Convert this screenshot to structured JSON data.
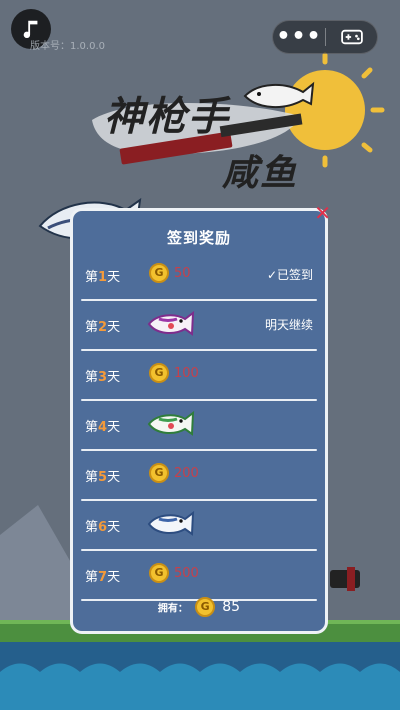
{
  "top": {
    "version": "版本号：1.0.0.0"
  },
  "logo": {
    "line1": "神枪手",
    "line2": "咸鱼"
  },
  "modal": {
    "title": "签到奖励",
    "close": "✕",
    "rows": [
      {
        "prefix": "第",
        "num": "1",
        "suffix": "天",
        "amount": "50",
        "status": "✓已签到"
      },
      {
        "prefix": "第",
        "num": "2",
        "suffix": "天",
        "amount": "",
        "status": "明天继续"
      },
      {
        "prefix": "第",
        "num": "3",
        "suffix": "天",
        "amount": "100",
        "status": ""
      },
      {
        "prefix": "第",
        "num": "4",
        "suffix": "天",
        "amount": "",
        "status": ""
      },
      {
        "prefix": "第",
        "num": "5",
        "suffix": "天",
        "amount": "200",
        "status": ""
      },
      {
        "prefix": "第",
        "num": "6",
        "suffix": "天",
        "amount": "",
        "status": ""
      },
      {
        "prefix": "第",
        "num": "7",
        "suffix": "天",
        "amount": "500",
        "status": ""
      }
    ],
    "footer_label": "拥有：",
    "coin_symbol": "G",
    "owned_coins": "85"
  },
  "colors": {
    "modal_bg": "#4e6d9a",
    "day_number": "#f39a3b",
    "amount": "#c7404a",
    "close": "#e0304a"
  },
  "icons": [
    "music-note-icon",
    "more-dots-icon",
    "gamepad-icon",
    "close-icon",
    "gold-coin-icon",
    "purple-fish-icon",
    "green-fish-icon",
    "blue-fish-icon"
  ]
}
